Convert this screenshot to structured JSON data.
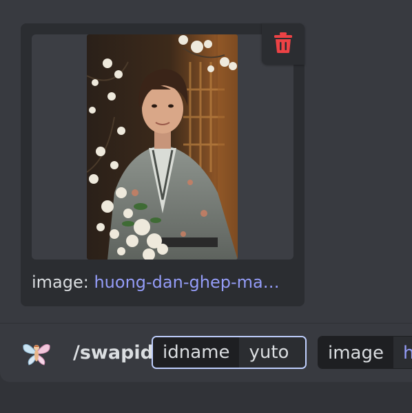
{
  "attachment": {
    "filename_label": "image: ",
    "filename_value": "huong-dan-ghep-ma…",
    "delete_icon": "trash-icon",
    "delete_color": "#ed4245"
  },
  "command_bar": {
    "avatar_icon": "fairy-avatar-icon",
    "command": "/swapid",
    "options": [
      {
        "name": "idname",
        "value": "yuto"
      },
      {
        "name": "image",
        "value": "h"
      }
    ]
  },
  "colors": {
    "background": "#313338",
    "panel": "#383a40",
    "card": "#2b2d31",
    "link": "#949cf7",
    "focus_border": "#c0d0ff"
  }
}
